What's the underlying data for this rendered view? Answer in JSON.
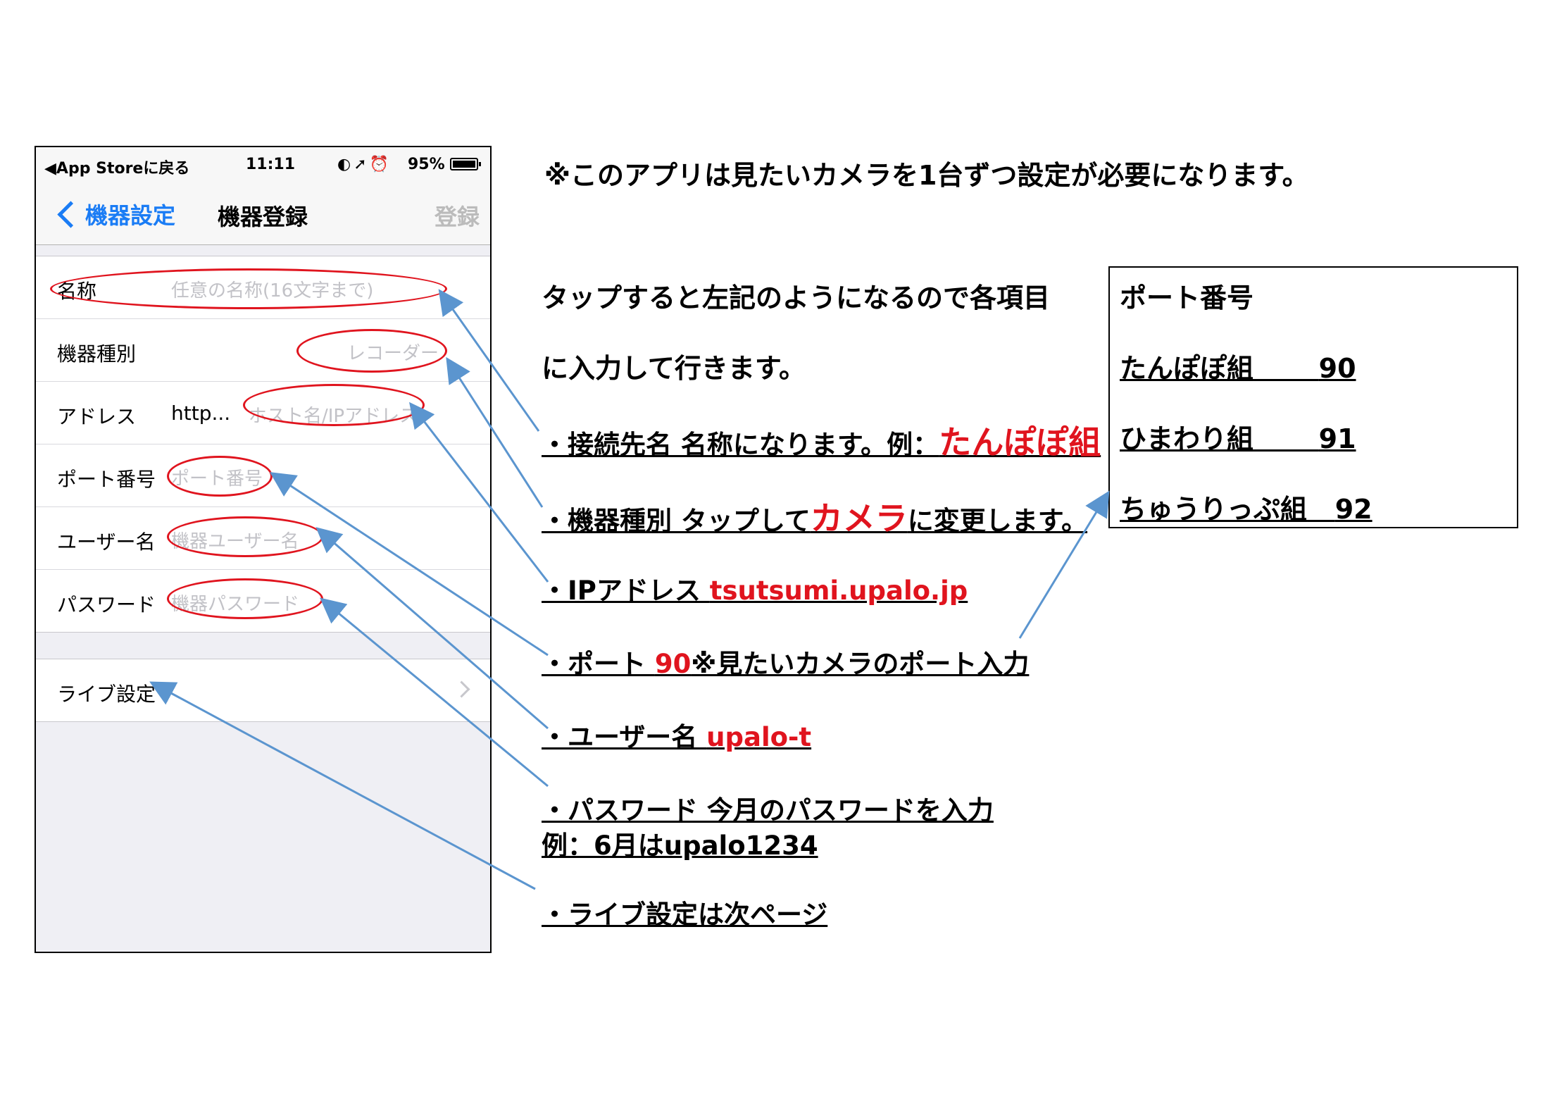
{
  "status_bar": {
    "back_app": "◀App Storeに戻る",
    "time": "11:11",
    "battery": "95%"
  },
  "nav": {
    "back_label": "機器設定",
    "title": "機器登録",
    "register": "登録"
  },
  "form": {
    "rows": [
      {
        "label": "名称",
        "placeholder": "任意の名称(16文字まで)"
      },
      {
        "label": "機器種別",
        "placeholder": "レコーダー"
      },
      {
        "label": "アドレス",
        "value": "http...",
        "placeholder": "ホスト名/IPアドレス"
      },
      {
        "label": "ポート番号",
        "placeholder": "ポート番号"
      },
      {
        "label": "ユーザー名",
        "placeholder": "機器ユーザー名"
      },
      {
        "label": "パスワード",
        "placeholder": "機器パスワード"
      }
    ],
    "live_setting": "ライブ設定"
  },
  "instructions": {
    "note": "※このアプリは見たいカメラを1台ずつ設定が必要になります。",
    "intro_line1": "タップすると左記のようになるので各項目",
    "intro_line2": "に入力して行きます。",
    "item1_prefix": "・接続先名 名称になります。例：",
    "item1_example": "たんぽぽ組",
    "item2_prefix": "・機器種別 タップして",
    "item2_highlight": "カメラ",
    "item2_suffix": "に変更します。",
    "item3_prefix": "・IPアドレス ",
    "item3_value": "tsutsumi.upalo.jp",
    "item4_prefix": "・ポート ",
    "item4_value": "90",
    "item4_suffix": "※見たいカメラのポート入力",
    "item5_prefix": "・ユーザー名 ",
    "item5_value": "upalo-t",
    "item6_line1": "・パスワード 今月のパスワードを入力",
    "item6_line2": "例：6月はupalo1234",
    "item7": "・ライブ設定は次ページ"
  },
  "port_table": {
    "title": "ポート番号",
    "rows": [
      {
        "name": "たんぽぽ組",
        "port": "90"
      },
      {
        "name": "ひまわり組",
        "port": "91"
      },
      {
        "name": "ちゅうりっぷ組",
        "port": "92"
      }
    ]
  },
  "colors": {
    "accent": "#e0141e",
    "ios_blue": "#1a7cf5",
    "arrow": "#5b95cf"
  }
}
